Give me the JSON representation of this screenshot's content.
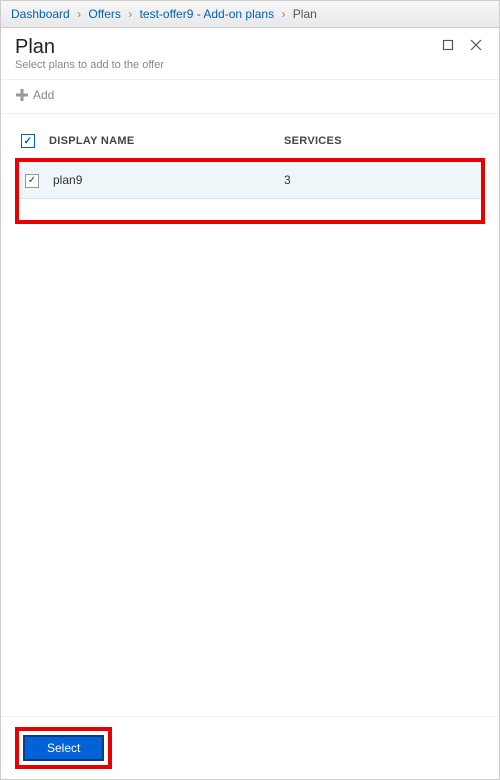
{
  "breadcrumb": {
    "items": [
      {
        "label": "Dashboard",
        "link": true
      },
      {
        "label": "Offers",
        "link": true
      },
      {
        "label": "test-offer9 - Add-on plans",
        "link": true
      },
      {
        "label": "Plan",
        "link": false
      }
    ]
  },
  "blade": {
    "title": "Plan",
    "subtitle": "Select plans to add to the offer"
  },
  "toolbar": {
    "add_label": "Add"
  },
  "table": {
    "headers": {
      "display_name": "DISPLAY NAME",
      "services": "SERVICES"
    },
    "rows": [
      {
        "selected": true,
        "display_name": "plan9",
        "services": "3"
      }
    ]
  },
  "footer": {
    "select_label": "Select"
  }
}
